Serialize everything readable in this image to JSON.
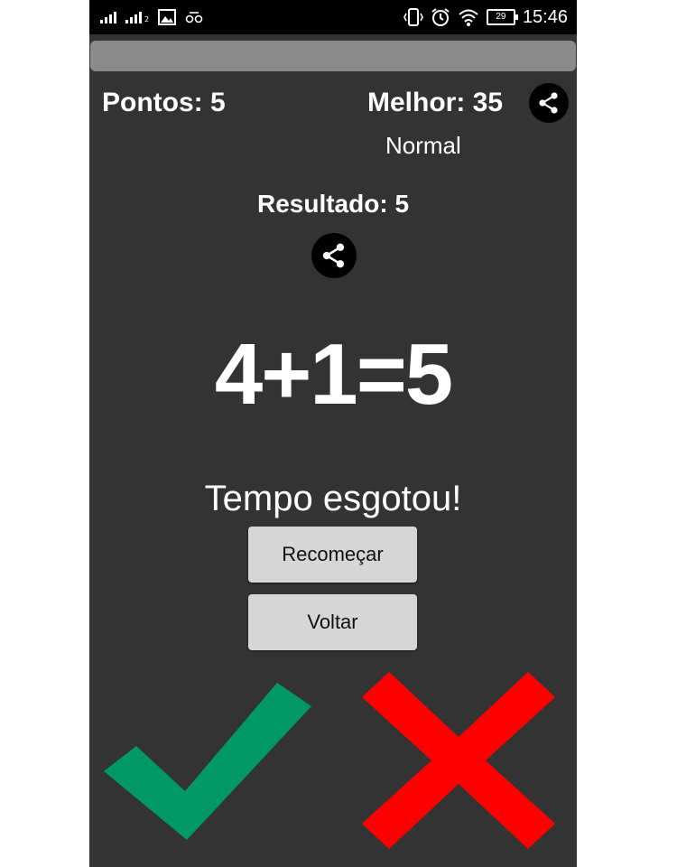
{
  "status_bar": {
    "time": "15:46",
    "battery": "29",
    "sim2_label": "2"
  },
  "scores": {
    "points_label": "Pontos: 5",
    "best_label": "Melhor: 35",
    "difficulty": "Normal"
  },
  "result_label": "Resultado: 5",
  "equation": "4+1=5",
  "timeout_message": "Tempo esgotou!",
  "buttons": {
    "restart": "Recomeçar",
    "back": "Voltar"
  },
  "icons": {
    "share": "share-icon",
    "correct": "check-icon",
    "wrong": "cross-icon"
  },
  "colors": {
    "background": "#333333",
    "check": "#009966",
    "cross": "#ff0000",
    "button": "#d6d6d6"
  }
}
